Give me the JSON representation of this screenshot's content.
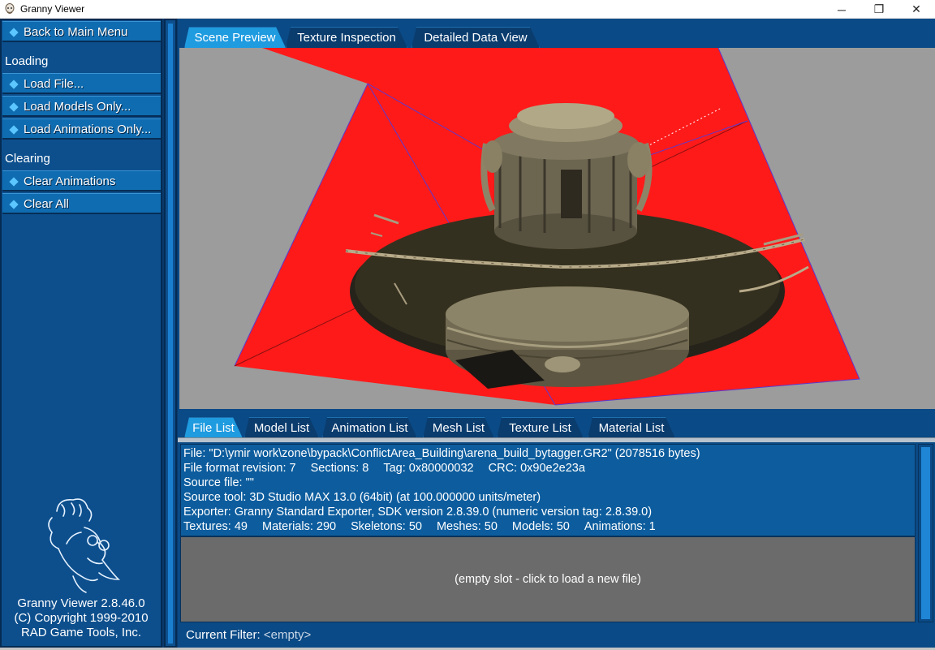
{
  "window": {
    "title": "Granny Viewer",
    "minimize_glyph": "─",
    "restore_glyph": "❐",
    "close_glyph": "✕"
  },
  "sidebar": {
    "back_label": "Back to Main Menu",
    "loading_header": "Loading",
    "loading_items": [
      "Load File...",
      "Load Models Only...",
      "Load Animations Only..."
    ],
    "clearing_header": "Clearing",
    "clearing_items": [
      "Clear Animations",
      "Clear All"
    ],
    "about": {
      "version": "Granny Viewer 2.8.46.0",
      "copyright": "(C) Copyright 1999-2010",
      "company": "RAD Game Tools, Inc."
    }
  },
  "top_tabs": [
    "Scene Preview",
    "Texture Inspection",
    "Detailed Data View"
  ],
  "bottom_tabs": [
    "File List",
    "Model List",
    "Animation List",
    "Mesh List",
    "Texture List",
    "Material List"
  ],
  "file_info": {
    "line1": "File: \"D:\\ymir work\\zone\\bypack\\ConflictArea_Building\\arena_build_bytagger.GR2\" (2078516 bytes)",
    "line2": [
      "File format revision: 7",
      "Sections: 8",
      "Tag: 0x80000032",
      "CRC: 0x90e2e23a"
    ],
    "line3": "Source file: \"\"",
    "line4": "Source tool: 3D Studio MAX 13.0 (64bit) (at 100.000000 units/meter)",
    "line5": "Exporter: Granny Standard Exporter, SDK version 2.8.39.0 (numeric version tag: 2.8.39.0)",
    "line6": [
      "Textures: 49",
      "Materials: 290",
      "Skeletons: 50",
      "Meshes: 50",
      "Models: 50",
      "Animations: 1"
    ]
  },
  "empty_slot": "(empty slot - click to load a new file)",
  "filter": {
    "label": "Current Filter:",
    "value": "<empty>"
  },
  "colors": {
    "accent": "#1f9be0",
    "panel": "#0a4a86",
    "plane": "#ff1a1a",
    "viewport_bg": "#9c9c9c"
  }
}
